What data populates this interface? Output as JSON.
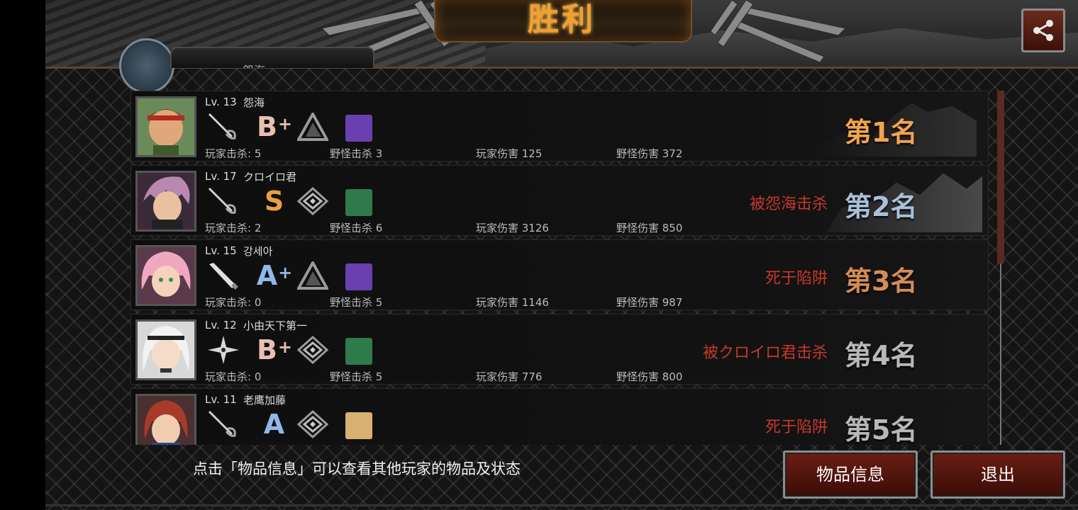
{
  "header": {
    "title": "胜利",
    "own_name_partial": "怨海"
  },
  "share_icon": "share-icon",
  "players": [
    {
      "level": "Lv. 13",
      "name": "怨海",
      "weapon_icon": "rapier-icon",
      "grade": "B",
      "grade_plus": "+",
      "rank_icon": "triangle-rank-icon",
      "item_icon": "purple-item-icon",
      "item_color": "#6a3fb0",
      "player_kills": "玩家击杀: 5",
      "monster_kills": "野怪击杀 3",
      "player_damage": "玩家伤害 125",
      "monster_damage": "野怪伤害 372",
      "death": "",
      "place": "第1名"
    },
    {
      "level": "Lv. 17",
      "name": "クロイロ君",
      "weapon_icon": "rapier-icon",
      "grade": "S",
      "grade_plus": "",
      "rank_icon": "diamond-rank-icon",
      "item_icon": "green-item-icon",
      "item_color": "#2f7a4a",
      "player_kills": "玩家击杀: 2",
      "monster_kills": "野怪击杀 6",
      "player_damage": "玩家伤害 3126",
      "monster_damage": "野怪伤害 850",
      "death": "被怨海击杀",
      "place": "第2名"
    },
    {
      "level": "Lv. 15",
      "name": "강세아",
      "weapon_icon": "bat-icon",
      "grade": "A",
      "grade_plus": "+",
      "rank_icon": "triangle-rank-icon",
      "item_icon": "purple-item-icon",
      "item_color": "#6a3fb0",
      "player_kills": "玩家击杀: 0",
      "monster_kills": "野怪击杀 5",
      "player_damage": "玩家伤害 1146",
      "monster_damage": "野怪伤害 987",
      "death": "死于陷阱",
      "place": "第3名"
    },
    {
      "level": "Lv. 12",
      "name": "小由天下第一",
      "weapon_icon": "shuriken-icon",
      "grade": "B",
      "grade_plus": "+",
      "rank_icon": "diamond-rank-icon",
      "item_icon": "green-item-icon",
      "item_color": "#2f7a4a",
      "player_kills": "玩家击杀: 0",
      "monster_kills": "野怪击杀 5",
      "player_damage": "玩家伤害 776",
      "monster_damage": "野怪伤害 800",
      "death": "被クロイロ君击杀",
      "place": "第4名"
    },
    {
      "level": "Lv. 11",
      "name": "老鹰加藤",
      "weapon_icon": "rapier-icon",
      "grade": "A",
      "grade_plus": "",
      "rank_icon": "diamond-rank-icon",
      "item_icon": "gold-item-icon",
      "item_color": "#d8b070",
      "player_kills": "",
      "monster_kills": "",
      "player_damage": "",
      "monster_damage": "",
      "death": "死于陷阱",
      "place": "第5名"
    }
  ],
  "footer": {
    "hint": "点击「物品信息」可以查看其他玩家的物品及状态",
    "items_button": "物品信息",
    "exit_button": "退出"
  }
}
